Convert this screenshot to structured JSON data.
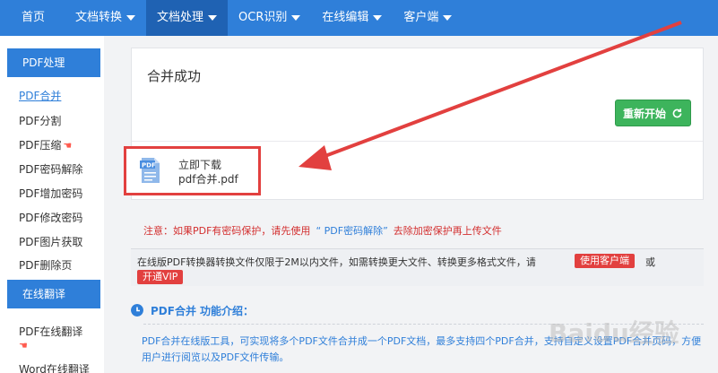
{
  "nav": {
    "items": [
      {
        "label": "首页",
        "caret": false,
        "active": false
      },
      {
        "label": "文档转换",
        "caret": true,
        "active": false
      },
      {
        "label": "文档处理",
        "caret": true,
        "active": true
      },
      {
        "label": "OCR识别",
        "caret": true,
        "active": false
      },
      {
        "label": "在线编辑",
        "caret": true,
        "active": false
      },
      {
        "label": "客户端",
        "caret": true,
        "active": false
      }
    ]
  },
  "sidebar": {
    "pdf_header": "PDF处理",
    "pdf_items": [
      "PDF合并",
      "PDF分割",
      "PDF压缩",
      "PDF密码解除",
      "PDF增加密码",
      "PDF修改密码",
      "PDF图片获取",
      "PDF删除页"
    ],
    "translate_header": "在线翻译",
    "translate_items": [
      "PDF在线翻译",
      "Word在线翻译"
    ]
  },
  "result": {
    "title": "合并成功",
    "restart_label": "重新开始",
    "download_label": "立即下载",
    "file_name": "pdf合并.pdf"
  },
  "notice": {
    "prefix": "注意：如果PDF有密码保护，请先使用",
    "link": "“ PDF密码解除”",
    "suffix": "去除加密保护再上传文件"
  },
  "info": {
    "text": "在线版PDF转换器转换文件仅限于2M以内文件，如需转换更大文件、转换更多格式文件，请",
    "client_button": "使用客户端",
    "or": "或",
    "vip_button": "开通VIP"
  },
  "intro": {
    "title_a": "PDF合并",
    "title_b": "功能介绍：",
    "body": "PDF合并在线版工具，可实现将多个PDF文件合并成一个PDF文档，最多支持四个PDF合并，支持自定义设置PDF合并页码，方便用户进行阅览以及PDF文件传输。"
  },
  "watermark": "Baidu经验",
  "colors": {
    "nav_blue": "#2f7fd9",
    "nav_active": "#1f62b3",
    "green": "#3db45c",
    "red": "#e2403f"
  }
}
